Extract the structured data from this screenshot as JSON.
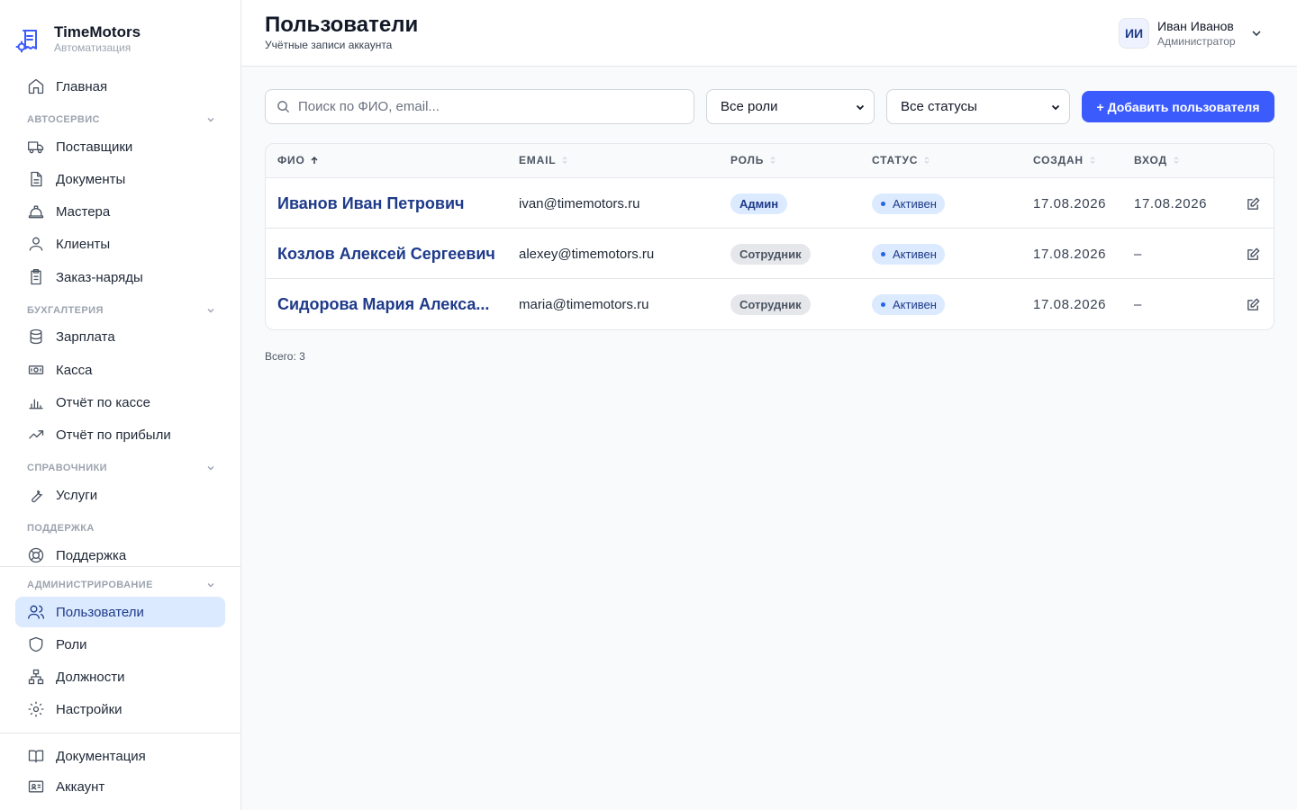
{
  "brand": {
    "name": "TimeMotors",
    "subtitle": "Автоматизация"
  },
  "sidebar": {
    "home": "Главная",
    "sections": [
      {
        "title": "АВТОСЕРВИС",
        "items": [
          "Поставщики",
          "Документы",
          "Мастера",
          "Клиенты",
          "Заказ-наряды"
        ]
      },
      {
        "title": "БУХГАЛТЕРИЯ",
        "items": [
          "Зарплата",
          "Касса",
          "Отчёт по кассе",
          "Отчёт по прибыли"
        ]
      },
      {
        "title": "СПРАВОЧНИКИ",
        "items": [
          "Услуги"
        ]
      },
      {
        "title": "ПОДДЕРЖКА",
        "items": [
          "Поддержка"
        ]
      },
      {
        "title": "АДМИНИСТРИРОВАНИЕ",
        "items": [
          "Пользователи",
          "Роли",
          "Должности",
          "Настройки"
        ]
      }
    ],
    "active_item": "Пользователи",
    "footer": [
      "Документация",
      "Аккаунт"
    ]
  },
  "header": {
    "title": "Пользователи",
    "subtitle": "Учётные записи аккаунта"
  },
  "user": {
    "initials": "ИИ",
    "name": "Иван Иванов",
    "role": "Администратор"
  },
  "toolbar": {
    "search_placeholder": "Поиск по ФИО, email...",
    "search_value": "",
    "role_filter": "Все роли",
    "status_filter": "Все статусы",
    "add_button": "+ Добавить пользователя"
  },
  "table": {
    "columns": [
      "ФИО",
      "EMAIL",
      "РОЛЬ",
      "СТАТУС",
      "СОЗДАН",
      "ВХОД"
    ],
    "sorted_column": "ФИО",
    "rows": [
      {
        "name": "Иванов Иван Петрович",
        "email": "ivan@timemotors.ru",
        "role": "Админ",
        "status": "Активен",
        "created": "17.08.2026",
        "login": "17.08.2026"
      },
      {
        "name": "Козлов Алексей Сергеевич",
        "email": "alexey@timemotors.ru",
        "role": "Сотрудник",
        "status": "Активен",
        "created": "17.08.2026",
        "login": "–"
      },
      {
        "name": "Сидорова Мария Алекса...",
        "email": "maria@timemotors.ru",
        "role": "Сотрудник",
        "status": "Активен",
        "created": "17.08.2026",
        "login": "–"
      }
    ],
    "total": "Всего: 3"
  },
  "colors": {
    "accent": "#3b5bfd",
    "link": "#1e3a8a",
    "active_bg": "#dbeafe"
  },
  "icons": {
    "sidebar": [
      "home-icon",
      "truck-icon",
      "document-icon",
      "hard-hat-icon",
      "user-icon",
      "clipboard-icon",
      "database-icon",
      "banknote-icon",
      "bar-chart-icon",
      "trending-up-icon",
      "wrench-icon",
      "lifebuoy-icon",
      "users-icon",
      "shield-icon",
      "org-chart-icon",
      "gear-icon",
      "book-icon",
      "id-card-icon"
    ]
  }
}
